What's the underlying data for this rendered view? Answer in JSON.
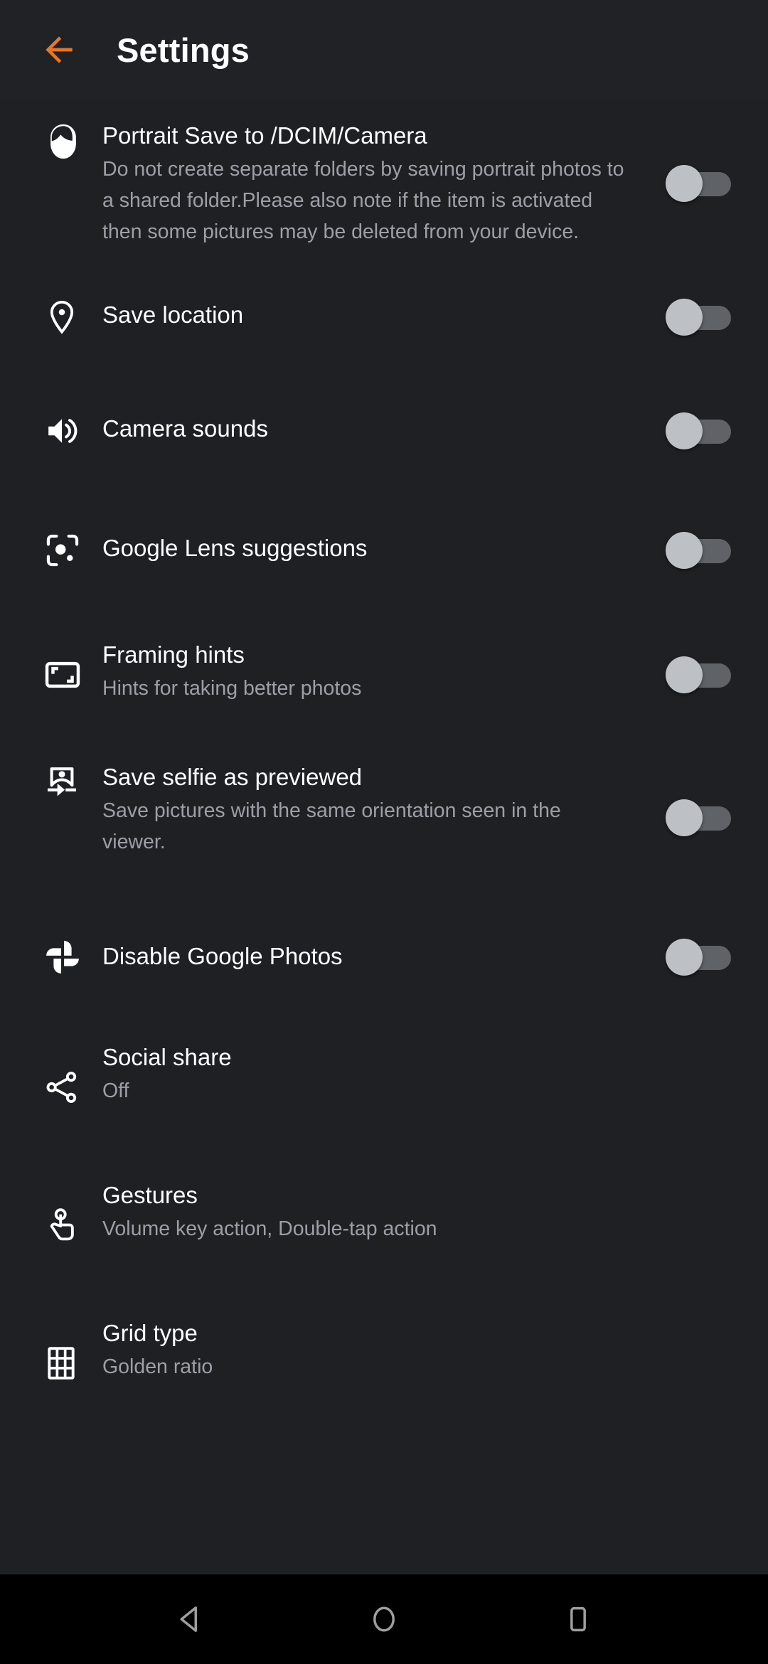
{
  "header": {
    "title": "Settings",
    "back_icon": "arrow-left-icon",
    "back_color": "#E87722"
  },
  "colors": {
    "background": "#1f2024",
    "appbar_background": "#212226",
    "title_text": "#ffffff",
    "summary_text": "#9aa0a6",
    "icon": "#ffffff",
    "switch_track_off": "#5f6368",
    "switch_thumb_off": "#bdc1c6",
    "navbar_background": "#000000",
    "navbar_icon": "#9e9e9e",
    "accent": "#E87722"
  },
  "settings": [
    {
      "icon": "portrait-face-icon",
      "title": "Portrait Save to /DCIM/Camera",
      "summary": "Do not create separate folders by saving portrait photos to a shared folder.Please also note if the item is activated then some pictures may be deleted from your device.",
      "control": "switch",
      "state": "off"
    },
    {
      "icon": "location-pin-icon",
      "title": "Save location",
      "summary": "",
      "control": "switch",
      "state": "off"
    },
    {
      "icon": "volume-up-icon",
      "title": "Camera sounds",
      "summary": "",
      "control": "switch",
      "state": "off"
    },
    {
      "icon": "google-lens-icon",
      "title": "Google Lens suggestions",
      "summary": "",
      "control": "switch",
      "state": "off"
    },
    {
      "icon": "framing-hints-icon",
      "title": "Framing hints",
      "summary": "Hints for taking better photos",
      "control": "switch",
      "state": "off"
    },
    {
      "icon": "save-selfie-icon",
      "title": "Save selfie as previewed",
      "summary": "Save pictures with the same orientation seen in the viewer.",
      "control": "switch",
      "state": "off"
    },
    {
      "icon": "google-photos-pinwheel-icon",
      "title": "Disable Google Photos",
      "summary": "",
      "control": "switch",
      "state": "off"
    },
    {
      "icon": "share-icon",
      "title": "Social share",
      "summary": "Off",
      "control": "none",
      "state": ""
    },
    {
      "icon": "touch-gesture-icon",
      "title": "Gestures",
      "summary": "Volume key action, Double-tap action",
      "control": "none",
      "state": ""
    },
    {
      "icon": "grid-icon",
      "title": "Grid type",
      "summary": "Golden ratio",
      "control": "none",
      "state": ""
    }
  ],
  "navbar": {
    "back": "nav-back-triangle-icon",
    "home": "nav-home-circle-icon",
    "recents": "nav-recents-square-icon"
  }
}
